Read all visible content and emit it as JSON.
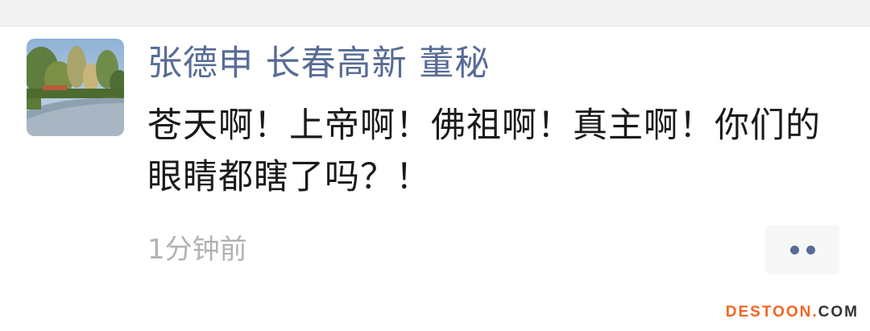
{
  "moment": {
    "author": "张德申 长春高新 董秘",
    "text": "苍天啊！上帝啊！佛祖啊！真主啊！你们的眼睛都瞎了吗？！",
    "timestamp": "1分钟前",
    "more_icon": "more-dots-icon",
    "link_color": "#576b95"
  },
  "watermark": {
    "brand": "DESTOON",
    "dot": ".",
    "tld": "COM"
  }
}
